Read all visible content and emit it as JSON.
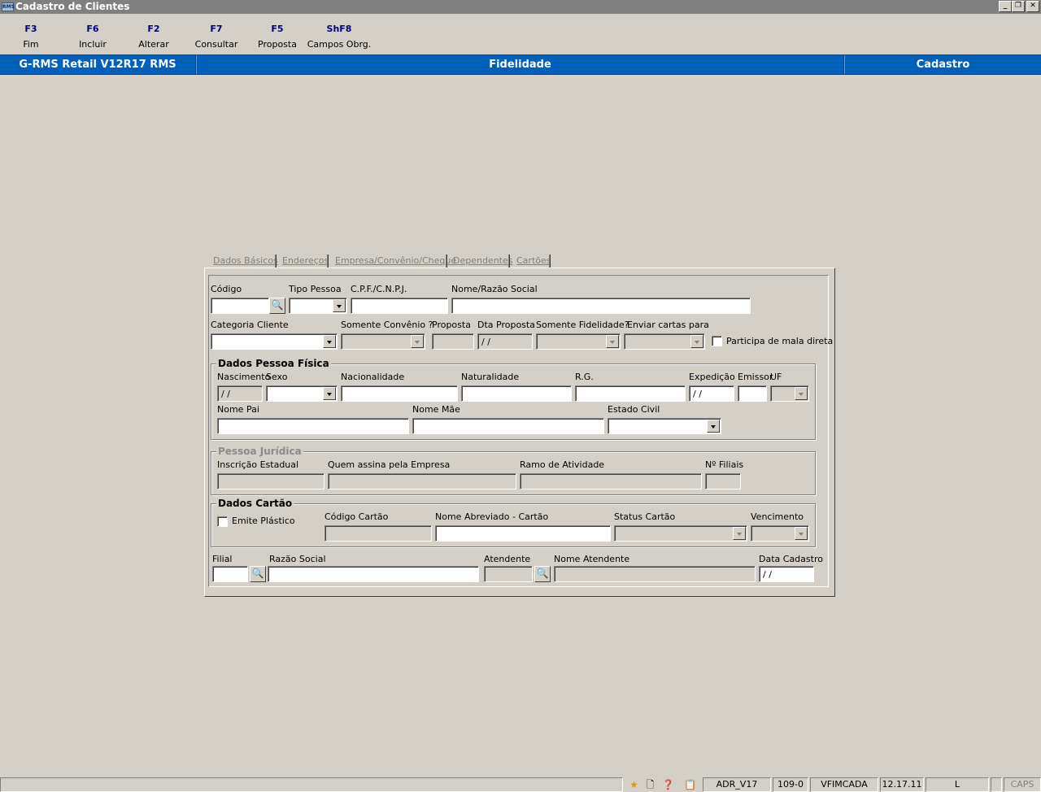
{
  "window": {
    "title": "Cadastro de Clientes",
    "icon_text": "RMS",
    "controls": {
      "minimize": "_",
      "restore": "❐",
      "close": "✕"
    }
  },
  "toolbar": [
    {
      "key": "F3",
      "label": "Fim"
    },
    {
      "key": "F6",
      "label": "Incluir"
    },
    {
      "key": "F2",
      "label": "Alterar"
    },
    {
      "key": "F7",
      "label": "Consultar"
    },
    {
      "key": "F5",
      "label": "Proposta"
    },
    {
      "key": "ShF8",
      "label": "Campos Obrg."
    }
  ],
  "band": {
    "product": "G-RMS Retail V12R17 RMS",
    "module": "Fidelidade",
    "screen": "Cadastro",
    "color": "#0060bb"
  },
  "tabs": [
    "Dados Básicos",
    "Endereços",
    "Empresa/Convênio/Cheque",
    "Dependentes",
    "Cartões"
  ],
  "basic": {
    "labels": {
      "codigo": "Código",
      "tipo_pessoa": "Tipo Pessoa",
      "cpf": "C.P.F./C.N.P.J.",
      "nome": "Nome/Razão Social",
      "categoria": "Categoria Cliente",
      "somente_convenio": "Somente Convênio ?",
      "proposta": "Proposta",
      "dta_proposta": "Dta Proposta",
      "somente_fidelidade": "Somente Fidelidade?",
      "enviar_cartas": "Enviar cartas para",
      "mala_direta": "Participa de mala direta"
    },
    "values": {
      "dta_proposta": " /  /"
    }
  },
  "pessoa_fisica": {
    "legend": "Dados Pessoa Física",
    "labels": {
      "nascimento": "Nascimento",
      "sexo": "Sexo",
      "nacionalidade": "Nacionalidade",
      "naturalidade": "Naturalidade",
      "rg": "R.G.",
      "expedicao": "Expedição",
      "emissor": "Emissor",
      "uf": "UF",
      "nome_pai": "Nome Pai",
      "nome_mae": "Nome Mãe",
      "estado_civil": "Estado Civil"
    },
    "values": {
      "nascimento": " /  /",
      "expedicao": " /  /"
    }
  },
  "pessoa_juridica": {
    "legend": "Pessoa Jurídica",
    "labels": {
      "inscricao": "Inscrição Estadual",
      "quem_assina": "Quem assina pela Empresa",
      "ramo": "Ramo de Atividade",
      "filiais": "Nº Filiais"
    }
  },
  "cartao": {
    "legend": "Dados Cartão",
    "labels": {
      "emite_plastico": "Emite Plástico",
      "codigo_cartao": "Código Cartão",
      "nome_abreviado": "Nome Abreviado - Cartão",
      "status": "Status Cartão",
      "vencimento": "Vencimento"
    }
  },
  "footer": {
    "labels": {
      "filial": "Filial",
      "razao_social": "Razão Social",
      "atendente": "Atendente",
      "nome_atendente": "Nome Atendente",
      "data_cadastro": "Data Cadastro"
    },
    "values": {
      "data_cadastro": " /  /"
    }
  },
  "statusbar": {
    "icons": [
      "star-icon",
      "page-icon",
      "help-icon",
      "clipboard-icon"
    ],
    "panels": [
      "ADR_V17",
      "109-0",
      "VFIMCADA",
      "12.17.11",
      "L",
      "",
      "CAPS"
    ]
  }
}
